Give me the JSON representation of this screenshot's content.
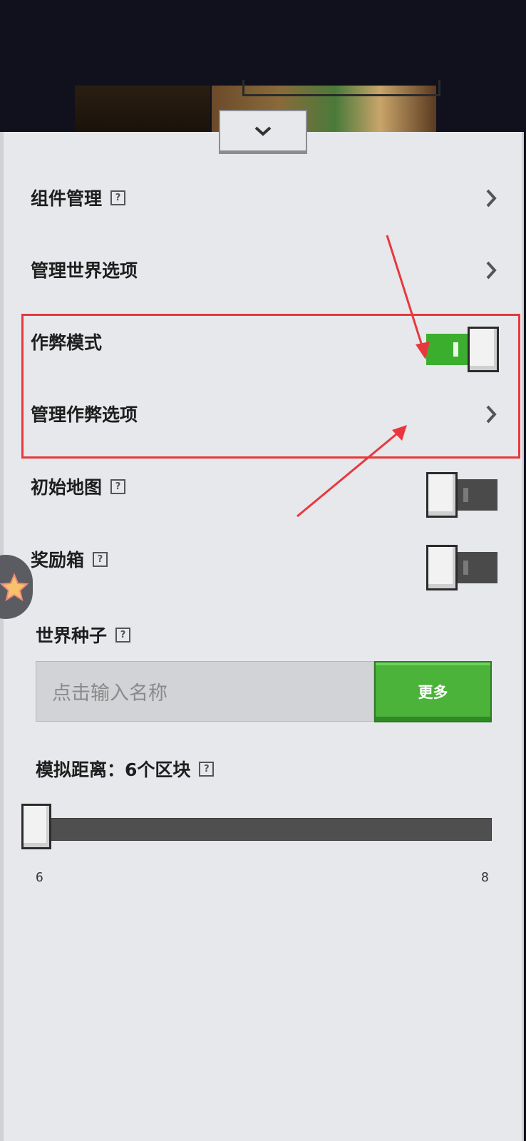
{
  "colors": {
    "panel_bg": "#e6e8eb",
    "toggle_on": "#3cae2e",
    "toggle_off": "#4a4a4a",
    "button_green": "#4bb23a",
    "highlight_red": "#e8383d"
  },
  "settings": {
    "rows": [
      {
        "label": "组件管理",
        "has_help": true,
        "control": "chevron"
      },
      {
        "label": "管理世界选项",
        "has_help": false,
        "control": "chevron"
      },
      {
        "label": "作弊模式",
        "has_help": false,
        "control": "toggle",
        "value": true
      },
      {
        "label": "管理作弊选项",
        "has_help": false,
        "control": "chevron"
      },
      {
        "label": "初始地图",
        "has_help": true,
        "control": "toggle",
        "value": false
      },
      {
        "label": "奖励箱",
        "has_help": true,
        "control": "toggle",
        "value": false
      }
    ],
    "help_glyph": "?"
  },
  "seed": {
    "label": "世界种子",
    "placeholder": "点击输入名称",
    "more_button": "更多"
  },
  "simulation": {
    "label": "模拟距离：6个区块",
    "value": 6,
    "min_label": "6",
    "max_label": "8",
    "min": 6,
    "max": 8
  },
  "icons": {
    "collapse": "chevron-down-icon",
    "row_arrow": "chevron-right-icon",
    "help": "help-icon",
    "float": "star-icon"
  }
}
